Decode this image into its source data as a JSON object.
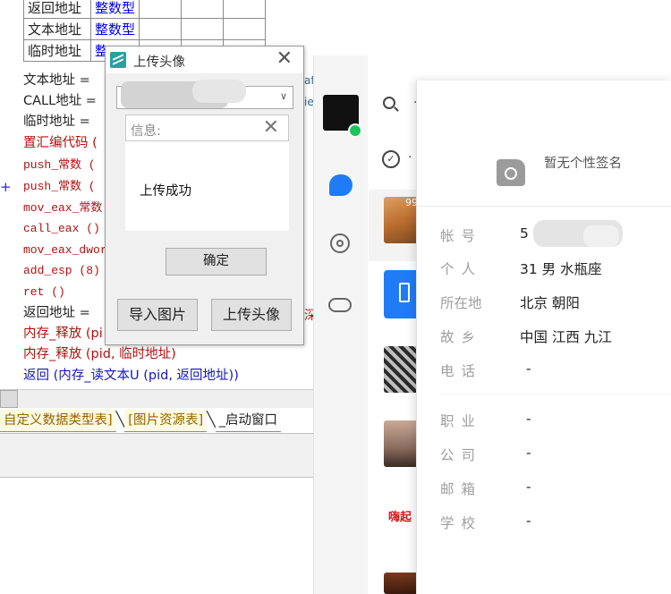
{
  "ide": {
    "var_table": [
      {
        "name": "返回地址",
        "type": "整数型"
      },
      {
        "name": "文本地址",
        "type": "整数型"
      },
      {
        "name": "临时地址",
        "type": "整"
      }
    ],
    "code_lines": [
      {
        "text": "文本地址 = ",
        "color": "black",
        "mono": false
      },
      {
        "text": "CALL地址 = ",
        "color": "black",
        "mono": false
      },
      {
        "text": "临时地址 = ",
        "color": "black",
        "mono": false
      },
      {
        "text": "置汇编代码 (",
        "color": "red",
        "mono": false
      },
      {
        "text": "push_常数 (",
        "color": "red",
        "mono": true
      },
      {
        "text": "push_常数 (",
        "color": "red",
        "mono": true
      },
      {
        "text": "mov_eax_常数",
        "color": "red",
        "mono": true
      },
      {
        "text": "call_eax ()",
        "color": "red",
        "mono": true
      },
      {
        "text": "mov_eax_dwor",
        "color": "red",
        "mono": true
      },
      {
        "text": "add_esp (8)",
        "color": "red",
        "mono": true
      },
      {
        "text": "ret ()",
        "color": "red",
        "mono": true
      },
      {
        "text": "返回地址 = ",
        "color": "black",
        "mono": false
      },
      {
        "text": "内存_释放 (pi",
        "color": "red",
        "mono": false
      },
      {
        "text": "内存_释放 (pid, 临时地址)",
        "color": "red",
        "mono": false
      },
      {
        "text": "返回 (内存_读文本U (pid, 返回地址))",
        "color": "blue",
        "mono": false
      }
    ],
    "margin_plus": "+",
    "side_glyphs": [
      "af",
      "ie",
      "深"
    ],
    "tabs": [
      {
        "label": "自定义数据类型表]"
      },
      {
        "label": "[图片资源表]"
      },
      {
        "label": "_启动窗口"
      }
    ],
    "tab_separator": "╲"
  },
  "upload_dialog": {
    "title": "上传头像",
    "close_glyph": "✕",
    "combo_arrow": "∨",
    "message_box": {
      "label": "信息:",
      "close_glyph": "✕",
      "text": "上传成功",
      "ok_label": "确定"
    },
    "import_button": "导入图片",
    "upload_button": "上传头像"
  },
  "chat_app": {
    "search_glyph": "·",
    "check_glyph": "✓",
    "check_text": "·",
    "first_thumb_badge": "99",
    "promo_text": "嗨起"
  },
  "profile": {
    "signature": "暂无个性签名",
    "fields": [
      {
        "label": "帐号",
        "value": "5"
      },
      {
        "label": "个人",
        "value": "31 男 水瓶座"
      },
      {
        "label": "所在地",
        "value": "北京 朝阳"
      },
      {
        "label": "故乡",
        "value": "中国 江西 九江"
      },
      {
        "label": "电话",
        "value": "-"
      },
      {
        "label": "职业",
        "value": "-"
      },
      {
        "label": "公司",
        "value": "-"
      },
      {
        "label": "邮箱",
        "value": "-"
      },
      {
        "label": "学校",
        "value": "-"
      }
    ]
  },
  "colors": {
    "accent_blue": "#1f7cf6",
    "online_green": "#1ec35c",
    "code_red": "#b21010",
    "code_blue": "#1616c0"
  }
}
